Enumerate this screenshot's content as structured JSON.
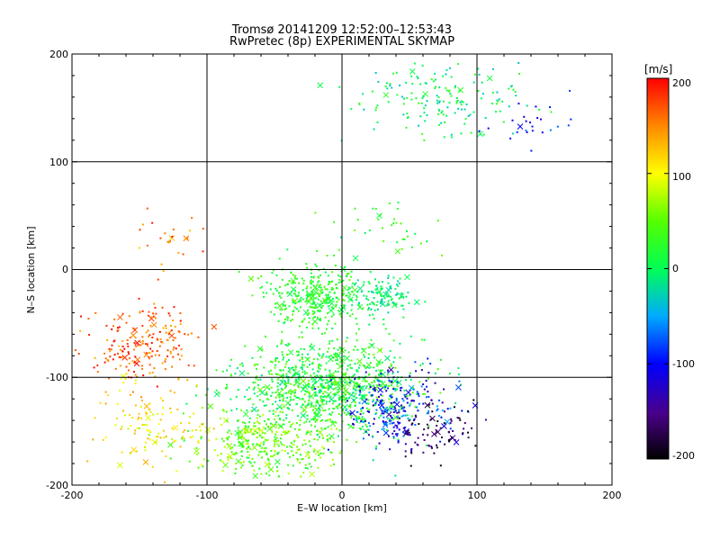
{
  "chart_data": {
    "type": "scatter",
    "title": "Tromsø 20141209 12:52:00–12:53:43",
    "subtitle": "RwPretec (8p) EXPERIMENTAL SKYMAP",
    "xlabel": "E–W location [km]",
    "ylabel": "N–S location [km]",
    "xlim": [
      -200,
      200
    ],
    "ylim": [
      -200,
      200
    ],
    "x_ticks": [
      "-200",
      "-100",
      "0",
      "100",
      "200"
    ],
    "y_ticks": [
      "-200",
      "-100",
      "0",
      "100",
      "200"
    ],
    "grid": true,
    "colorbar": {
      "label": "[m/s]",
      "range": [
        -200,
        200
      ],
      "ticks": [
        "200",
        "100",
        "0",
        "-100",
        "-200"
      ]
    },
    "markers": [
      "small dot",
      "x"
    ],
    "clusters": [
      {
        "x_center": -10,
        "y_center": -110,
        "x_spread": 55,
        "y_spread": 35,
        "count": 900,
        "velocity": [
          -20,
          60
        ],
        "note": "dense central-south region"
      },
      {
        "x_center": -55,
        "y_center": -160,
        "x_spread": 45,
        "y_spread": 25,
        "count": 350,
        "velocity": [
          10,
          90
        ]
      },
      {
        "x_center": 40,
        "y_center": -130,
        "x_spread": 35,
        "y_spread": 30,
        "count": 250,
        "velocity": [
          -140,
          -40
        ]
      },
      {
        "x_center": 70,
        "y_center": -150,
        "x_spread": 25,
        "y_spread": 25,
        "count": 80,
        "velocity": [
          -200,
          -140
        ]
      },
      {
        "x_center": -150,
        "y_center": -70,
        "x_spread": 35,
        "y_spread": 30,
        "count": 200,
        "velocity": [
          130,
          200
        ]
      },
      {
        "x_center": -140,
        "y_center": -140,
        "x_spread": 40,
        "y_spread": 35,
        "count": 120,
        "velocity": [
          80,
          140
        ]
      },
      {
        "x_center": -20,
        "y_center": -25,
        "x_spread": 30,
        "y_spread": 25,
        "count": 350,
        "velocity": [
          0,
          50
        ]
      },
      {
        "x_center": 30,
        "y_center": -25,
        "x_spread": 20,
        "y_spread": 15,
        "count": 120,
        "velocity": [
          -30,
          20
        ]
      },
      {
        "x_center": 70,
        "y_center": 160,
        "x_spread": 55,
        "y_spread": 30,
        "count": 170,
        "velocity": [
          -40,
          40
        ]
      },
      {
        "x_center": 140,
        "y_center": 140,
        "x_spread": 25,
        "y_spread": 25,
        "count": 25,
        "velocity": [
          -120,
          -60
        ]
      },
      {
        "x_center": -130,
        "y_center": 30,
        "x_spread": 25,
        "y_spread": 20,
        "count": 25,
        "velocity": [
          120,
          200
        ]
      },
      {
        "x_center": 30,
        "y_center": 40,
        "x_spread": 40,
        "y_spread": 25,
        "count": 40,
        "velocity": [
          -10,
          60
        ]
      }
    ]
  }
}
